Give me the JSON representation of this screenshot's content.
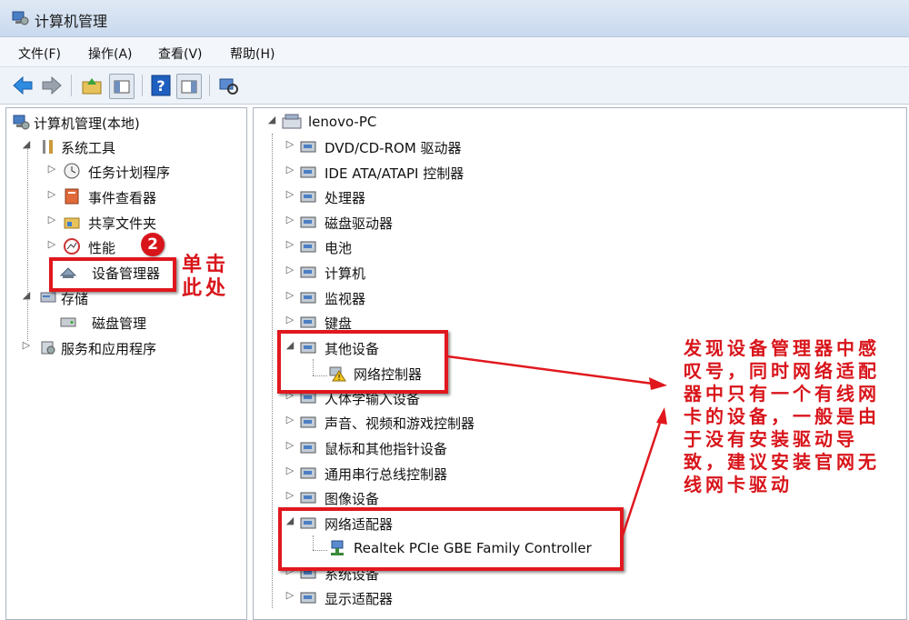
{
  "window": {
    "title": "计算机管理"
  },
  "menu": [
    "文件(F)",
    "操作(A)",
    "查看(V)",
    "帮助(H)"
  ],
  "left_tree": {
    "root": "计算机管理(本地)",
    "system_tools": "系统工具",
    "items": [
      "任务计划程序",
      "事件查看器",
      "共享文件夹",
      "性能",
      "设备管理器"
    ],
    "storage": "存储",
    "disk_mgmt": "磁盘管理",
    "services": "服务和应用程序"
  },
  "right_tree": {
    "root": "lenovo-PC",
    "categories": [
      "DVD/CD-ROM 驱动器",
      "IDE ATA/ATAPI 控制器",
      "处理器",
      "磁盘驱动器",
      "电池",
      "计算机",
      "监视器",
      "键盘",
      "其他设备",
      "人体学输入设备",
      "声音、视频和游戏控制器",
      "鼠标和其他指针设备",
      "通用串行总线控制器",
      "图像设备",
      "网络适配器",
      "系统设备",
      "显示适配器"
    ],
    "other_device_child": "网络控制器",
    "network_adapter_child": "Realtek PCIe GBE Family Controller"
  },
  "annotations": {
    "step_badge": "2",
    "click_here": "单击此处",
    "note": "发现设备管理器中感叹号，同时网络适配器中只有一个有线网卡的设备，一般是由于没有安装驱动导致，建议安装官网无线网卡驱动"
  },
  "colors": {
    "annotation": "#e0181e",
    "accent": "#2f6fc0"
  }
}
